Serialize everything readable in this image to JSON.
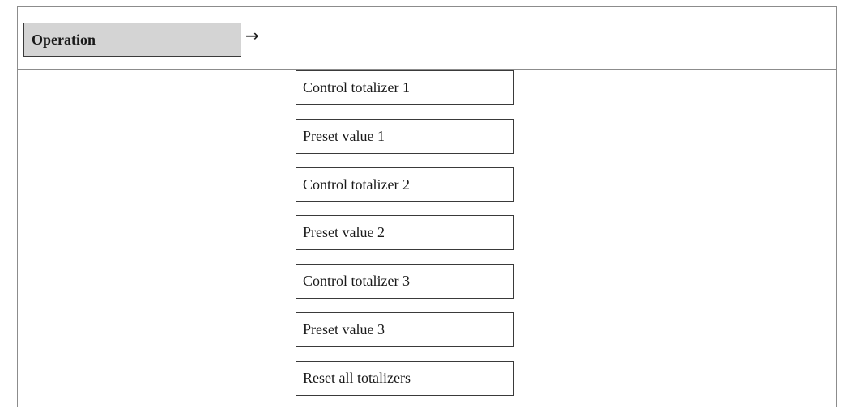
{
  "menu": {
    "label": "Operation",
    "arrow": "→"
  },
  "items": [
    "Control totalizer 1",
    "Preset value 1",
    "Control totalizer 2",
    "Preset value 2",
    "Control totalizer 3",
    "Preset value 3",
    "Reset all totalizers"
  ]
}
